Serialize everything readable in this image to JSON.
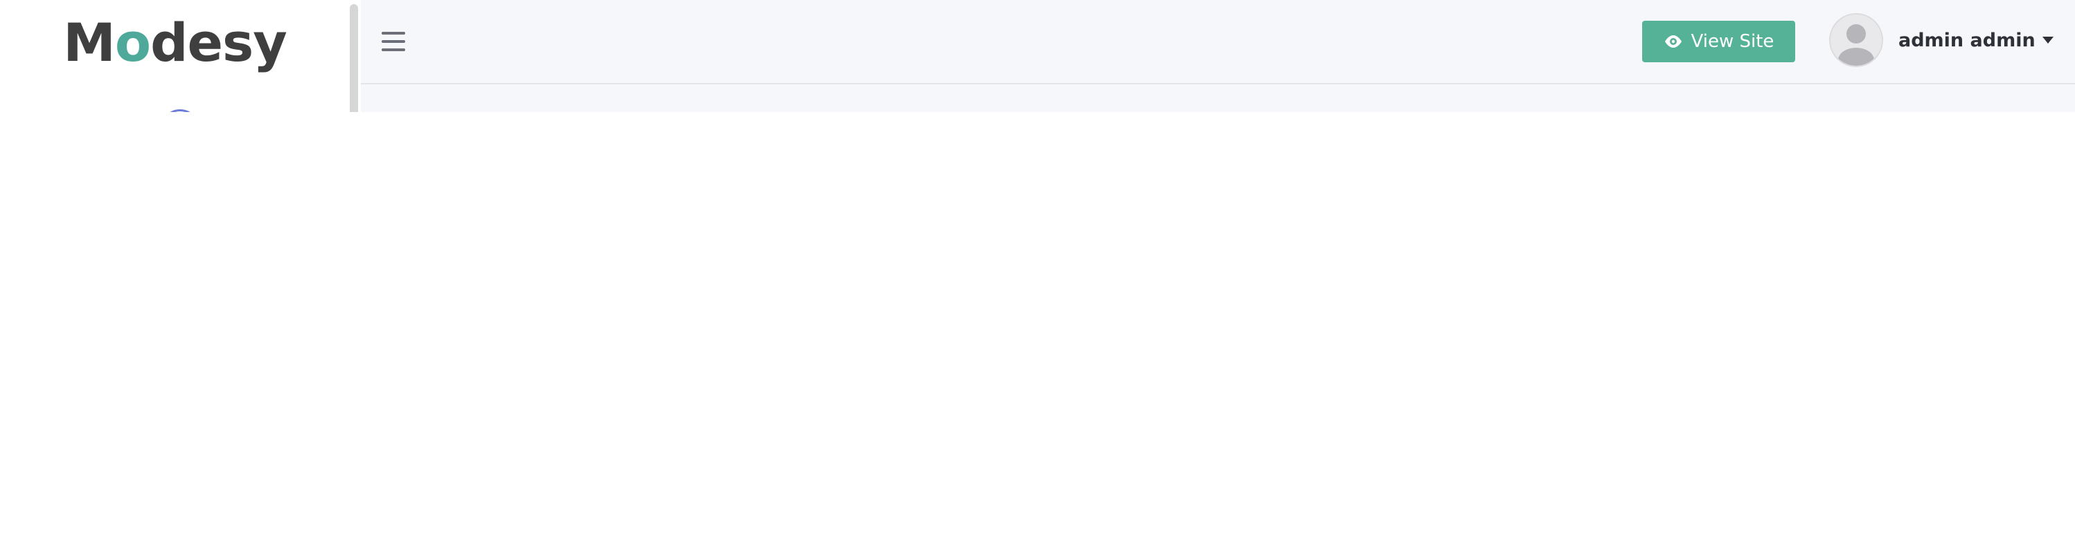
{
  "sidebar": {
    "logo": {
      "part1": "M",
      "accent": "o",
      "part2": "desy"
    }
  },
  "header": {
    "menu_icon": "hamburger-menu-icon",
    "view_site_label": "View Site",
    "view_site_icon": "eye-icon",
    "user": {
      "name": "admin admin",
      "avatar_icon": "user-avatar-icon",
      "dropdown_icon": "caret-down-icon"
    }
  },
  "colors": {
    "brand_accent": "#4fa99a",
    "button_bg": "#55b296",
    "topbar_bg": "#f6f7fb",
    "text_dark": "#2e3138"
  }
}
